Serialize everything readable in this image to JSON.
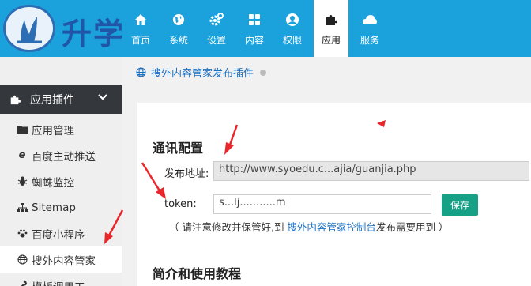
{
  "logo": {
    "text": "升学"
  },
  "nav": [
    {
      "label": "首页",
      "icon": "home-icon"
    },
    {
      "label": "系统",
      "icon": "globe-icon"
    },
    {
      "label": "设置",
      "icon": "gear-icon"
    },
    {
      "label": "内容",
      "icon": "grid-icon"
    },
    {
      "label": "权限",
      "icon": "user-icon"
    },
    {
      "label": "应用",
      "icon": "puzzle-icon",
      "active": true
    },
    {
      "label": "服务",
      "icon": "cloud-icon"
    }
  ],
  "sidebar": {
    "header": "应用插件",
    "items": [
      {
        "label": "应用管理",
        "icon": "folder-icon"
      },
      {
        "label": "百度主动推送",
        "icon": "ie-icon"
      },
      {
        "label": "蜘蛛监控",
        "icon": "bug-icon"
      },
      {
        "label": "Sitemap",
        "icon": "sitemap-icon"
      },
      {
        "label": "百度小程序",
        "icon": "paw-icon"
      },
      {
        "label": "搜外内容管家",
        "icon": "globe-icon",
        "active": true
      },
      {
        "label": "模板调用工",
        "icon": "tool-icon"
      }
    ]
  },
  "breadcrumb": {
    "label": "搜外内容管家发布插件"
  },
  "sections": {
    "comm": "通讯配置",
    "intro": "简介和使用教程"
  },
  "form": {
    "publish_label": "发布地址:",
    "publish_value": "http://www.syoedu.c...ajia/guanjia.php",
    "token_label": "token:",
    "token_value": "s...lj...........m",
    "save_label": "保存"
  },
  "note": {
    "prefix": "（ 请注意修改并保管好,到 ",
    "link": "搜外内容管家控制台",
    "suffix": "发布需要用到 ）"
  },
  "colors": {
    "topbar": "#1ba1dc",
    "sidebar_header": "#34383d",
    "save": "#16a085",
    "annotation": "#e8262b"
  }
}
